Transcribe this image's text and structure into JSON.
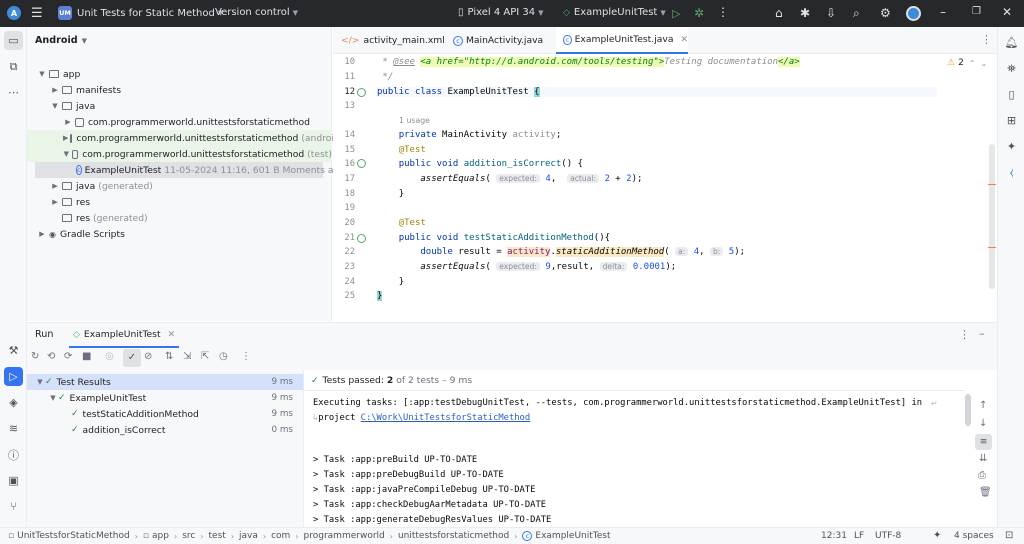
{
  "titlebar": {
    "project_badge": "UM",
    "project_name": "Unit Tests for Static Method",
    "vcs": "Version control",
    "device": "Pixel 4 API 34",
    "run_config": "ExampleUnitTest",
    "icons": [
      "android-logo",
      "hamburger-menu-icon",
      "device-icon",
      "junit-icon",
      "run-icon",
      "debug-icon",
      "profile-icon",
      "sync-gradle-icon",
      "device-manager-icon",
      "search-icon",
      "settings-icon",
      "account-icon",
      "minimize-icon",
      "maximize-icon",
      "close-icon"
    ]
  },
  "project": {
    "view": "Android",
    "tree": [
      {
        "label": "app",
        "muted": "",
        "level": 0,
        "type": "folder",
        "arrow": "down"
      },
      {
        "label": "manifests",
        "muted": "",
        "level": 1,
        "type": "folder",
        "arrow": "right"
      },
      {
        "label": "java",
        "muted": "",
        "level": 1,
        "type": "folder",
        "arrow": "down"
      },
      {
        "label": "com.programmerworld.unittestsforstaticmethod",
        "muted": "",
        "level": 2,
        "type": "package",
        "arrow": "right"
      },
      {
        "label": "com.programmerworld.unittestsforstaticmethod",
        "muted": "(androidTest)",
        "level": 2,
        "type": "package",
        "arrow": "right"
      },
      {
        "label": "com.programmerworld.unittestsforstaticmethod",
        "muted": "(test)",
        "level": 2,
        "type": "package",
        "arrow": "down"
      },
      {
        "label": "ExampleUnitTest",
        "muted": "11-05-2024 11:16, 601 B Moments ago",
        "level": 3,
        "type": "class",
        "arrow": ""
      },
      {
        "label": "java",
        "muted": "(generated)",
        "level": 1,
        "type": "folder",
        "arrow": "right"
      },
      {
        "label": "res",
        "muted": "",
        "level": 1,
        "type": "folder",
        "arrow": "right"
      },
      {
        "label": "res",
        "muted": "(generated)",
        "level": 1,
        "type": "folder",
        "arrow": ""
      },
      {
        "label": "Gradle Scripts",
        "muted": "",
        "level": 0,
        "type": "gradle",
        "arrow": "right"
      }
    ]
  },
  "editor": {
    "tabs": [
      {
        "label": "activity_main.xml",
        "active": false
      },
      {
        "label": "MainActivity.java",
        "active": false
      },
      {
        "label": "ExampleUnitTest.java",
        "active": true
      }
    ],
    "warnings": "2",
    "gutter": [
      "10",
      "11",
      "12",
      "13",
      "",
      "14",
      "15",
      "16",
      "17",
      "18",
      "19",
      "20",
      "21",
      "22",
      "23",
      "24",
      "25"
    ],
    "see_tag": "@see",
    "see_link": "<a href=\"http://d.android.com/tools/testing\">",
    "see_text": "Testing documentation",
    "see_close": "</a>",
    "comment_end": "*/",
    "public": "public",
    "class": "class",
    "class_name": "ExampleUnitTest",
    "open_brace": "{",
    "usage": "1 usage",
    "private": "private",
    "field_type": "MainActivity",
    "field_name": "activity",
    "semi": ";",
    "test_annotation": "@Test",
    "void": "void",
    "method1": "addition_isCorrect",
    "parens_open": "() {",
    "assert": "assertEquals",
    "hint_expected": "expected:",
    "hint_actual": "actual:",
    "val4": "4",
    "val2a": "2",
    "plus": "+",
    "val2b": "2",
    "close_call": ");",
    "close_brace": "}",
    "method2": "testStaticAdditionMethod",
    "parens_open2": "(){",
    "double": "double",
    "result_decl": "result =",
    "activity_ref": "activity",
    "static_method": "staticAdditionMethod",
    "hint_a": "a:",
    "hint_b": "b:",
    "arg4": "4",
    "arg5": "5",
    "val9": "9",
    "result_word": "result,",
    "hint_delta": "delta:",
    "delta_val": "0.0001"
  },
  "run": {
    "tab_run": "Run",
    "tab_test": "ExampleUnitTest",
    "summary_prefix": "Tests passed:",
    "summary_passed": "2",
    "summary_suffix": "of 2 tests – 9 ms",
    "results": [
      {
        "label": "Test Results",
        "time": "9 ms",
        "level": 0,
        "selected": true
      },
      {
        "label": "ExampleUnitTest",
        "time": "9 ms",
        "level": 1,
        "selected": false
      },
      {
        "label": "testStaticAdditionMethod",
        "time": "9 ms",
        "level": 2,
        "selected": false
      },
      {
        "label": "addition_isCorrect",
        "time": "0 ms",
        "level": 2,
        "selected": false
      }
    ],
    "console_exec": "Executing tasks: [:app:testDebugUnitTest, --tests, com.programmerworld.unittestsforstaticmethod.ExampleUnitTest] in",
    "console_project": "project ",
    "console_path": "C:\\Work\\UnitTestsforStaticMethod",
    "tasks": [
      "> Task :app:preBuild UP-TO-DATE",
      "> Task :app:preDebugBuild UP-TO-DATE",
      "> Task :app:javaPreCompileDebug UP-TO-DATE",
      "> Task :app:checkDebugAarMetadata UP-TO-DATE",
      "> Task :app:generateDebugResValues UP-TO-DATE"
    ]
  },
  "status": {
    "breadcrumbs": [
      "UnitTestsforStaticMethod",
      "app",
      "src",
      "test",
      "java",
      "com",
      "programmerworld",
      "unittestsforstaticmethod",
      "ExampleUnitTest"
    ],
    "position": "12:31",
    "line_sep": "LF",
    "encoding": "UTF-8",
    "indent": "4 spaces"
  },
  "colors": {
    "accent": "#3574f0",
    "pass": "#208a3c",
    "titlebar": "#27282c"
  }
}
